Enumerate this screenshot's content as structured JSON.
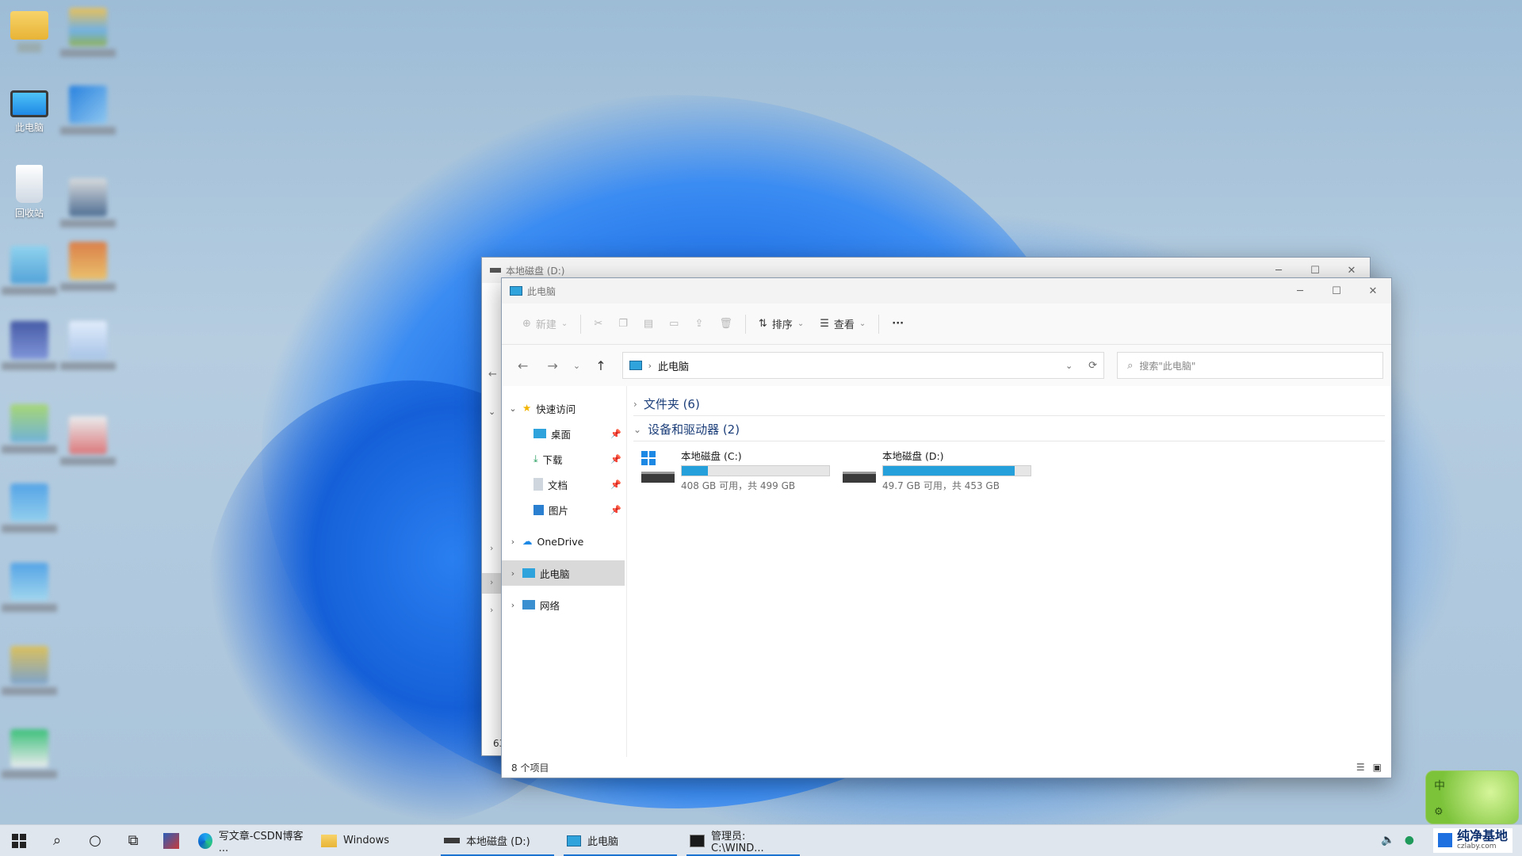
{
  "desktop": {
    "icons": [
      {
        "label": ""
      },
      {
        "label": "此电脑"
      },
      {
        "label": "回收站"
      }
    ]
  },
  "back_window": {
    "title": "本地磁盘 (D:)",
    "status_partial": "63"
  },
  "window": {
    "title": "此电脑",
    "toolbar": {
      "new_label": "新建",
      "sort_label": "排序",
      "view_label": "查看",
      "more_label": "···"
    },
    "address": {
      "path": "此电脑",
      "search_placeholder": "搜索\"此电脑\""
    },
    "sidebar": {
      "items": [
        {
          "label": "快速访问"
        },
        {
          "label": "桌面"
        },
        {
          "label": "下载"
        },
        {
          "label": "文档"
        },
        {
          "label": "图片"
        },
        {
          "label": "OneDrive"
        },
        {
          "label": "此电脑"
        },
        {
          "label": "网络"
        }
      ]
    },
    "groups": [
      {
        "label": "文件夹 (6)"
      },
      {
        "label": "设备和驱动器 (2)"
      }
    ],
    "drives": [
      {
        "name": "本地磁盘 (C:)",
        "info": "408 GB 可用，共 499 GB",
        "used_fraction": 0.18
      },
      {
        "name": "本地磁盘 (D:)",
        "info": "49.7 GB 可用，共 453 GB",
        "used_fraction": 0.89
      }
    ],
    "status": "8 个项目"
  },
  "taskbar": {
    "tasks": [
      {
        "label": "写文章-CSDN博客 ..."
      },
      {
        "label": "Windows"
      },
      {
        "label": "本地磁盘 (D:)"
      },
      {
        "label": "此电脑"
      },
      {
        "label": "管理员: C:\\WIND..."
      }
    ],
    "watermark": "纯净基地",
    "watermark_url": "czlaby.com",
    "ime": "中"
  },
  "colors": {
    "accent": "#26a0da",
    "taskbar_active": "#1b73d1"
  }
}
